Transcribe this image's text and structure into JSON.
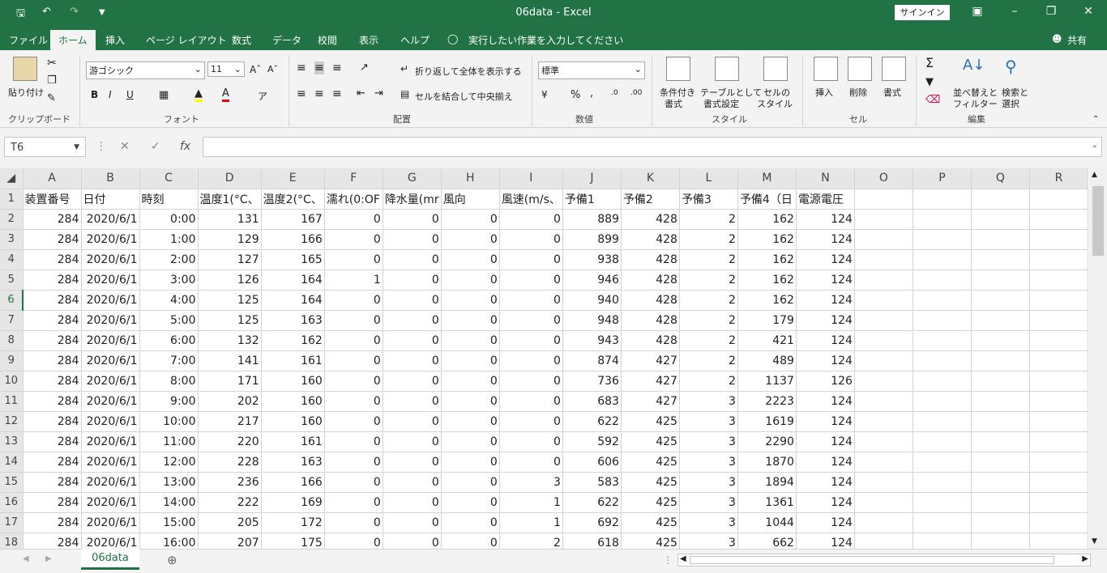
{
  "title": "06data  -  Excel",
  "signin": "サインイン",
  "menus": [
    "ファイル",
    "ホーム",
    "挿入",
    "ページ レイアウト",
    "数式",
    "データ",
    "校閲",
    "表示",
    "ヘルプ",
    "実行したい作業を入力してください"
  ],
  "share": "共有",
  "ribbon": {
    "paste": "貼り付け",
    "clipboard": "クリップボード",
    "font_name": "游ゴシック",
    "font_size": "11",
    "font_group": "フォント",
    "wrap_text": "折り返して全体を表示する",
    "merge_center": "セルを結合して中央揃え",
    "alignment_group": "配置",
    "number_format": "標準",
    "number_group": "数値",
    "cond_format_1": "条件付き",
    "cond_format_2": "書式",
    "table_format_1": "テーブルとして",
    "table_format_2": "書式設定",
    "cell_style_1": "セルの",
    "cell_style_2": "スタイル",
    "styles_group": "スタイル",
    "insert": "挿入",
    "delete": "削除",
    "format": "書式",
    "cells_group": "セル",
    "sort_filter_1": "並べ替えと",
    "sort_filter_2": "フィルター",
    "find_select_1": "検索と",
    "find_select_2": "選択",
    "editing_group": "編集"
  },
  "name_box": "T6",
  "columns": [
    "A",
    "B",
    "C",
    "D",
    "E",
    "F",
    "G",
    "H",
    "I",
    "J",
    "K",
    "L",
    "M",
    "N",
    "O",
    "P",
    "Q",
    "R"
  ],
  "header_row": [
    "装置番号",
    "日付",
    "時刻",
    "温度1(°C、",
    "温度2(°C、",
    "濡れ(0:OF",
    "降水量(mr",
    "風向",
    "風速(m/s、",
    "予備1",
    "予備2",
    "予備3",
    "予備4（日",
    "電源電圧"
  ],
  "rows": [
    [
      "284",
      "2020/6/1",
      "0:00",
      "131",
      "167",
      "0",
      "0",
      "0",
      "0",
      "889",
      "428",
      "2",
      "162",
      "124"
    ],
    [
      "284",
      "2020/6/1",
      "1:00",
      "129",
      "166",
      "0",
      "0",
      "0",
      "0",
      "899",
      "428",
      "2",
      "162",
      "124"
    ],
    [
      "284",
      "2020/6/1",
      "2:00",
      "127",
      "165",
      "0",
      "0",
      "0",
      "0",
      "938",
      "428",
      "2",
      "162",
      "124"
    ],
    [
      "284",
      "2020/6/1",
      "3:00",
      "126",
      "164",
      "1",
      "0",
      "0",
      "0",
      "946",
      "428",
      "2",
      "162",
      "124"
    ],
    [
      "284",
      "2020/6/1",
      "4:00",
      "125",
      "164",
      "0",
      "0",
      "0",
      "0",
      "940",
      "428",
      "2",
      "162",
      "124"
    ],
    [
      "284",
      "2020/6/1",
      "5:00",
      "125",
      "163",
      "0",
      "0",
      "0",
      "0",
      "948",
      "428",
      "2",
      "179",
      "124"
    ],
    [
      "284",
      "2020/6/1",
      "6:00",
      "132",
      "162",
      "0",
      "0",
      "0",
      "0",
      "943",
      "428",
      "2",
      "421",
      "124"
    ],
    [
      "284",
      "2020/6/1",
      "7:00",
      "141",
      "161",
      "0",
      "0",
      "0",
      "0",
      "874",
      "427",
      "2",
      "489",
      "124"
    ],
    [
      "284",
      "2020/6/1",
      "8:00",
      "171",
      "160",
      "0",
      "0",
      "0",
      "0",
      "736",
      "427",
      "2",
      "1137",
      "126"
    ],
    [
      "284",
      "2020/6/1",
      "9:00",
      "202",
      "160",
      "0",
      "0",
      "0",
      "0",
      "683",
      "427",
      "3",
      "2223",
      "124"
    ],
    [
      "284",
      "2020/6/1",
      "10:00",
      "217",
      "160",
      "0",
      "0",
      "0",
      "0",
      "622",
      "425",
      "3",
      "1619",
      "124"
    ],
    [
      "284",
      "2020/6/1",
      "11:00",
      "220",
      "161",
      "0",
      "0",
      "0",
      "0",
      "592",
      "425",
      "3",
      "2290",
      "124"
    ],
    [
      "284",
      "2020/6/1",
      "12:00",
      "228",
      "163",
      "0",
      "0",
      "0",
      "0",
      "606",
      "425",
      "3",
      "1870",
      "124"
    ],
    [
      "284",
      "2020/6/1",
      "13:00",
      "236",
      "166",
      "0",
      "0",
      "0",
      "3",
      "583",
      "425",
      "3",
      "1894",
      "124"
    ],
    [
      "284",
      "2020/6/1",
      "14:00",
      "222",
      "169",
      "0",
      "0",
      "0",
      "1",
      "622",
      "425",
      "3",
      "1361",
      "124"
    ],
    [
      "284",
      "2020/6/1",
      "15:00",
      "205",
      "172",
      "0",
      "0",
      "0",
      "1",
      "692",
      "425",
      "3",
      "1044",
      "124"
    ],
    [
      "284",
      "2020/6/1",
      "16:00",
      "207",
      "175",
      "0",
      "0",
      "0",
      "2",
      "618",
      "425",
      "3",
      "662",
      "124"
    ]
  ],
  "sheet_tab": "06data"
}
